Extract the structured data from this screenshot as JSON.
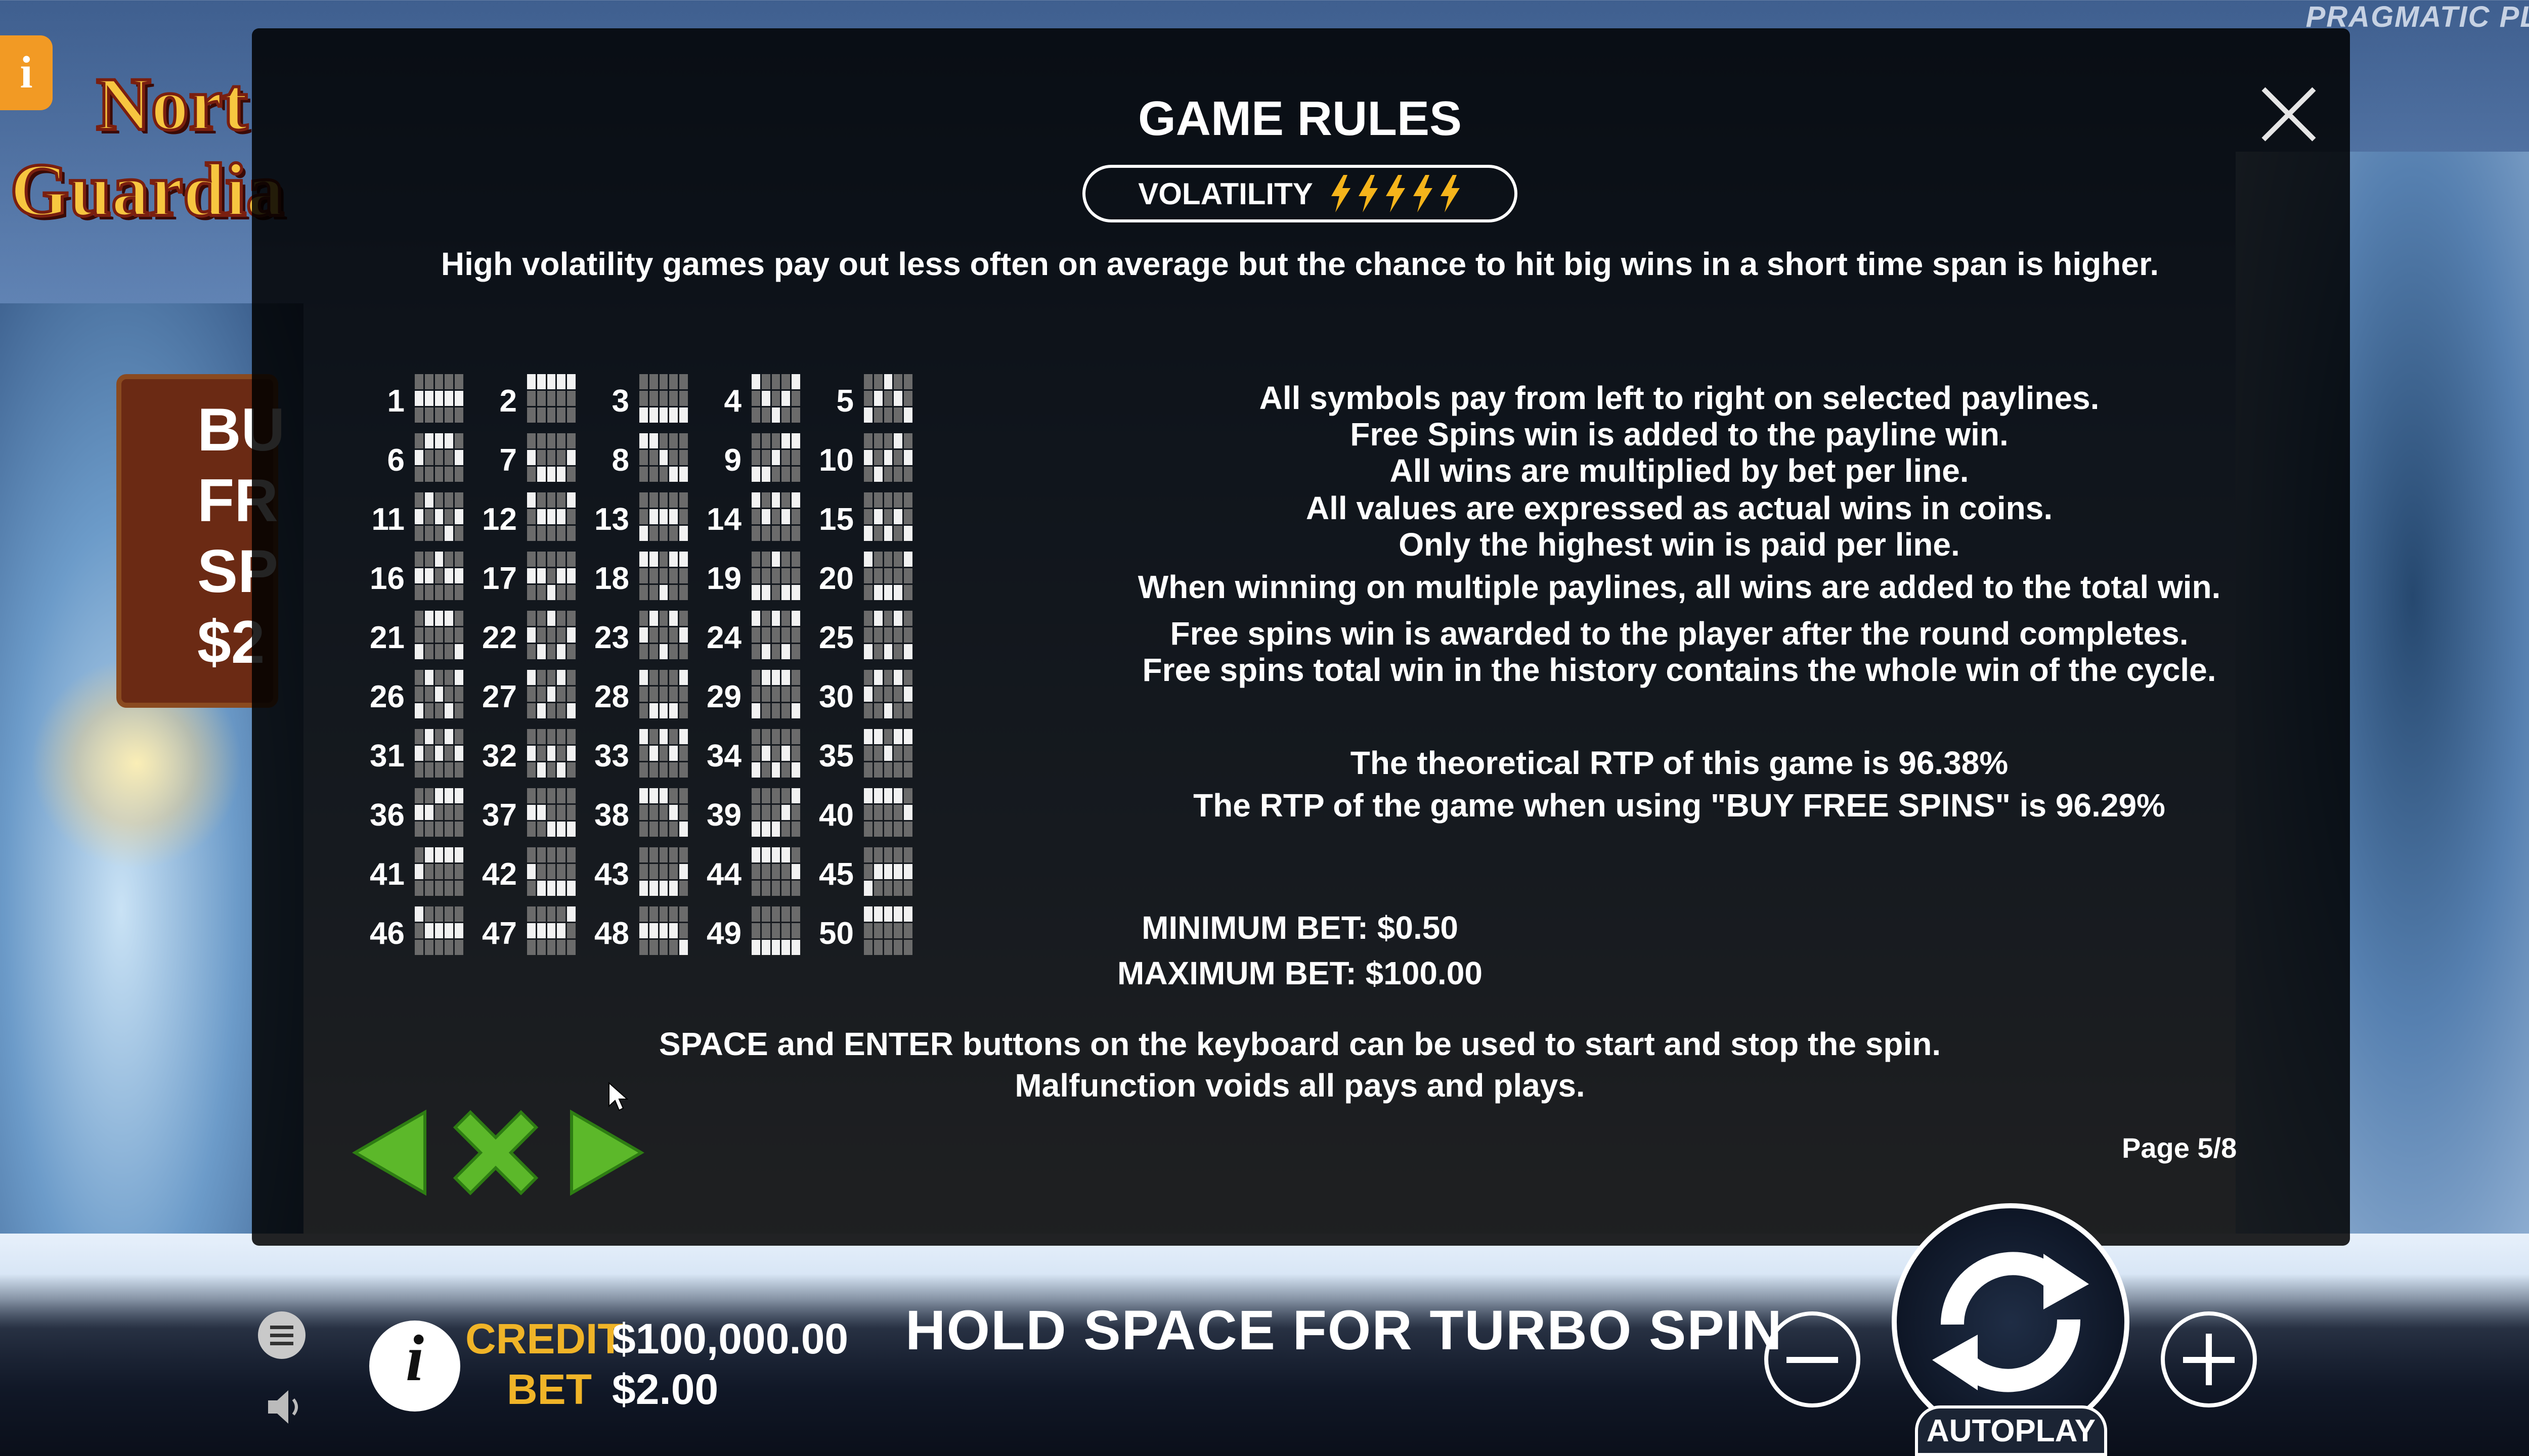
{
  "background": {
    "provider_logo": "PRAGMATIC PLAY",
    "game_logo_line1": "Nort",
    "game_logo_line2": "Guardia",
    "buy_banner_text": "BU FR SP $2",
    "top_left_icon": "info-icon"
  },
  "modal": {
    "title": "GAME RULES",
    "volatility_label": "VOLATILITY",
    "volatility_level": 5,
    "volatility_max": 5,
    "volatility_description": "High volatility games pay out less often on average but the chance to hit big wins in a short time span is higher.",
    "paylines": [
      {
        "num": "1",
        "rows": [
          1,
          1,
          1,
          1,
          1
        ]
      },
      {
        "num": "2",
        "rows": [
          0,
          0,
          0,
          0,
          0
        ]
      },
      {
        "num": "3",
        "rows": [
          2,
          2,
          2,
          2,
          2
        ]
      },
      {
        "num": "4",
        "rows": [
          0,
          1,
          2,
          1,
          0
        ]
      },
      {
        "num": "5",
        "rows": [
          2,
          1,
          0,
          1,
          2
        ]
      },
      {
        "num": "6",
        "rows": [
          1,
          0,
          0,
          0,
          1
        ]
      },
      {
        "num": "7",
        "rows": [
          1,
          2,
          2,
          2,
          1
        ]
      },
      {
        "num": "8",
        "rows": [
          0,
          0,
          1,
          2,
          2
        ]
      },
      {
        "num": "9",
        "rows": [
          2,
          2,
          1,
          0,
          0
        ]
      },
      {
        "num": "10",
        "rows": [
          1,
          2,
          1,
          0,
          1
        ]
      },
      {
        "num": "11",
        "rows": [
          1,
          0,
          1,
          2,
          1
        ]
      },
      {
        "num": "12",
        "rows": [
          0,
          1,
          1,
          1,
          0
        ]
      },
      {
        "num": "13",
        "rows": [
          2,
          1,
          1,
          1,
          2
        ]
      },
      {
        "num": "14",
        "rows": [
          0,
          1,
          0,
          1,
          0
        ]
      },
      {
        "num": "15",
        "rows": [
          2,
          1,
          2,
          1,
          2
        ]
      },
      {
        "num": "16",
        "rows": [
          1,
          1,
          0,
          1,
          1
        ]
      },
      {
        "num": "17",
        "rows": [
          1,
          1,
          2,
          1,
          1
        ]
      },
      {
        "num": "18",
        "rows": [
          0,
          0,
          2,
          0,
          0
        ]
      },
      {
        "num": "19",
        "rows": [
          2,
          2,
          0,
          2,
          2
        ]
      },
      {
        "num": "20",
        "rows": [
          0,
          2,
          2,
          2,
          0
        ]
      },
      {
        "num": "21",
        "rows": [
          2,
          0,
          0,
          0,
          2
        ]
      },
      {
        "num": "22",
        "rows": [
          1,
          2,
          0,
          2,
          1
        ]
      },
      {
        "num": "23",
        "rows": [
          1,
          0,
          2,
          0,
          1
        ]
      },
      {
        "num": "24",
        "rows": [
          0,
          2,
          0,
          2,
          0
        ]
      },
      {
        "num": "25",
        "rows": [
          2,
          0,
          2,
          0,
          2
        ]
      },
      {
        "num": "26",
        "rows": [
          2,
          0,
          1,
          2,
          0
        ]
      },
      {
        "num": "27",
        "rows": [
          0,
          2,
          1,
          0,
          2
        ]
      },
      {
        "num": "28",
        "rows": [
          0,
          2,
          2,
          2,
          0
        ]
      },
      {
        "num": "29",
        "rows": [
          2,
          0,
          0,
          0,
          2
        ]
      },
      {
        "num": "30",
        "rows": [
          1,
          0,
          2,
          0,
          1
        ]
      },
      {
        "num": "31",
        "rows": [
          1,
          0,
          1,
          0,
          1
        ]
      },
      {
        "num": "32",
        "rows": [
          1,
          2,
          1,
          2,
          1
        ]
      },
      {
        "num": "33",
        "rows": [
          0,
          1,
          0,
          1,
          0
        ]
      },
      {
        "num": "34",
        "rows": [
          2,
          1,
          2,
          1,
          2
        ]
      },
      {
        "num": "35",
        "rows": [
          0,
          0,
          1,
          0,
          0
        ]
      },
      {
        "num": "36",
        "rows": [
          1,
          1,
          0,
          0,
          0
        ]
      },
      {
        "num": "37",
        "rows": [
          1,
          1,
          2,
          2,
          2
        ]
      },
      {
        "num": "38",
        "rows": [
          0,
          0,
          0,
          1,
          2
        ]
      },
      {
        "num": "39",
        "rows": [
          2,
          2,
          2,
          1,
          0
        ]
      },
      {
        "num": "40",
        "rows": [
          0,
          0,
          0,
          0,
          1
        ]
      },
      {
        "num": "41",
        "rows": [
          1,
          0,
          0,
          0,
          0
        ]
      },
      {
        "num": "42",
        "rows": [
          1,
          2,
          2,
          2,
          2
        ]
      },
      {
        "num": "43",
        "rows": [
          2,
          2,
          2,
          2,
          1
        ]
      },
      {
        "num": "44",
        "rows": [
          0,
          0,
          0,
          0,
          1
        ]
      },
      {
        "num": "45",
        "rows": [
          2,
          1,
          1,
          1,
          1
        ]
      },
      {
        "num": "46",
        "rows": [
          0,
          1,
          1,
          1,
          1
        ]
      },
      {
        "num": "47",
        "rows": [
          1,
          1,
          1,
          1,
          0
        ]
      },
      {
        "num": "48",
        "rows": [
          1,
          1,
          1,
          1,
          2
        ]
      },
      {
        "num": "49",
        "rows": [
          2,
          2,
          2,
          2,
          2
        ]
      },
      {
        "num": "50",
        "rows": [
          0,
          0,
          0,
          0,
          0
        ]
      }
    ],
    "rules_lines": [
      "All symbols pay from left to right on selected paylines.",
      "Free Spins win is added to the payline win.",
      "All wins are multiplied by bet per line.",
      "All values are expressed as actual wins in coins.",
      "Only the highest win is paid per line.",
      "When winning on multiple paylines, all wins are added to the total win.",
      "Free spins win is awarded to the player after the round completes.",
      "Free spins total win in the history contains the whole win of the cycle."
    ],
    "rtp_lines": [
      "The theoretical RTP of this game is 96.38%",
      "The RTP of the game when using \"BUY FREE SPINS\" is 96.29%"
    ],
    "min_bet": "MINIMUM BET: $0.50",
    "max_bet": "MAXIMUM BET: $100.00",
    "keyboard_line1": "SPACE and ENTER buttons on the keyboard can be used to start and stop the spin.",
    "keyboard_line2": "Malfunction voids all pays and plays.",
    "page_indicator": "Page 5/8",
    "colors": {
      "nav_green": "#5cb82a",
      "nav_green_dark": "#2e7d13",
      "bolt_yellow": "#f5b41b"
    }
  },
  "footer": {
    "credit_label": "CREDIT",
    "credit_value": "$100,000.00",
    "bet_label": "BET",
    "bet_value": "$2.00",
    "turbo_message": "HOLD SPACE FOR TURBO SPIN",
    "autoplay_label": "AUTOPLAY",
    "accent": "#f0b428"
  }
}
